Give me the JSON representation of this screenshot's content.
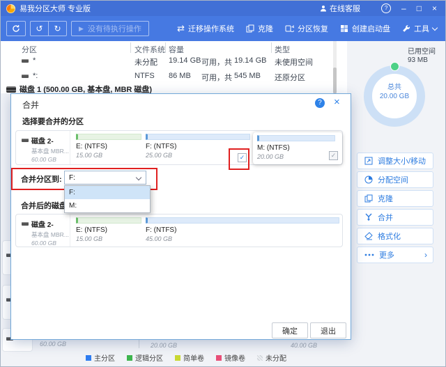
{
  "titlebar": {
    "app_title": "易我分区大师 专业版",
    "online_service": "在线客服"
  },
  "toolbar": {
    "pending": "没有待执行操作",
    "migrate": "迁移操作系统",
    "clone": "克隆",
    "recovery": "分区恢复",
    "bootdisk": "创建启动盘",
    "tools": "工具"
  },
  "table": {
    "headers": {
      "partition": "分区",
      "filesystem": "文件系统",
      "capacity": "容量",
      "type": "类型"
    },
    "rows": [
      {
        "name": "*",
        "fs": "未分配",
        "free": "19.14 GB",
        "mid": "可用，共",
        "total": "19.14 GB",
        "type": "未使用空间"
      },
      {
        "name": "*:",
        "fs": "NTFS",
        "free": "86 MB",
        "mid": "可用，共",
        "total": "545 MB",
        "type": "还原分区"
      }
    ],
    "disk1": "磁盘 1 (500.00 GB, 基本盘, MBR 磁盘)"
  },
  "sidebar": {
    "used_label": "已用空间",
    "used_value": "93 MB",
    "total_label": "总共",
    "total_value": "20.00 GB",
    "actions": [
      {
        "label": "调整大小/移动"
      },
      {
        "label": "分配空间"
      },
      {
        "label": "克隆"
      },
      {
        "label": "合并"
      },
      {
        "label": "格式化"
      },
      {
        "label": "更多"
      }
    ]
  },
  "dialog": {
    "title": "合并",
    "select_section": "选择要合并的分区",
    "disk": {
      "name": "磁盘 2-",
      "subtype": "基本盘 MBR...",
      "size": "60.00 GB"
    },
    "partitions": [
      {
        "label": "E: (NTFS)",
        "size": "15.00 GB"
      },
      {
        "label": "F: (NTFS)",
        "size": "25.00 GB"
      },
      {
        "label": "M: (NTFS)",
        "size": "20.00 GB"
      }
    ],
    "merge_to_label": "合并分区到:",
    "merge_to_value": "F:",
    "options": [
      "F:",
      "M:"
    ],
    "result_section": "合并后的磁盘",
    "result_disk": {
      "name": "磁盘 2-",
      "subtype": "基本盘 MBR...",
      "size": "60.00 GB"
    },
    "result_partitions": [
      {
        "label": "E: (NTFS)",
        "size": "15.00 GB"
      },
      {
        "label": "F: (NTFS)",
        "size": "45.00 GB"
      }
    ],
    "ok": "确定",
    "exit": "退出"
  },
  "background": {
    "sizes": [
      "60.00 GB",
      "20.00 GB",
      "40.00 GB"
    ]
  },
  "legend": {
    "items": [
      {
        "label": "主分区",
        "color": "#2f7df0"
      },
      {
        "label": "逻辑分区",
        "color": "#3eb54e"
      },
      {
        "label": "简单卷",
        "color": "#c9d832"
      },
      {
        "label": "镜像卷",
        "color": "#e84f78"
      },
      {
        "label": "未分配",
        "color": "#d9dde2"
      }
    ]
  },
  "colors": {
    "titlebar": "#4170d6",
    "toolbar": "#4679e2",
    "accent": "#2d7ce0",
    "annotation": "#e02020",
    "donut_ring": "#cde0f6",
    "donut_dot": "#4ed187"
  },
  "icons": {
    "minimize": "–",
    "maximize": "□",
    "close": "×",
    "question": "?",
    "undo": "↺",
    "redo": "↻",
    "play": "▶",
    "migrate": "⇄",
    "check": "✓",
    "more_arrow": "›"
  }
}
